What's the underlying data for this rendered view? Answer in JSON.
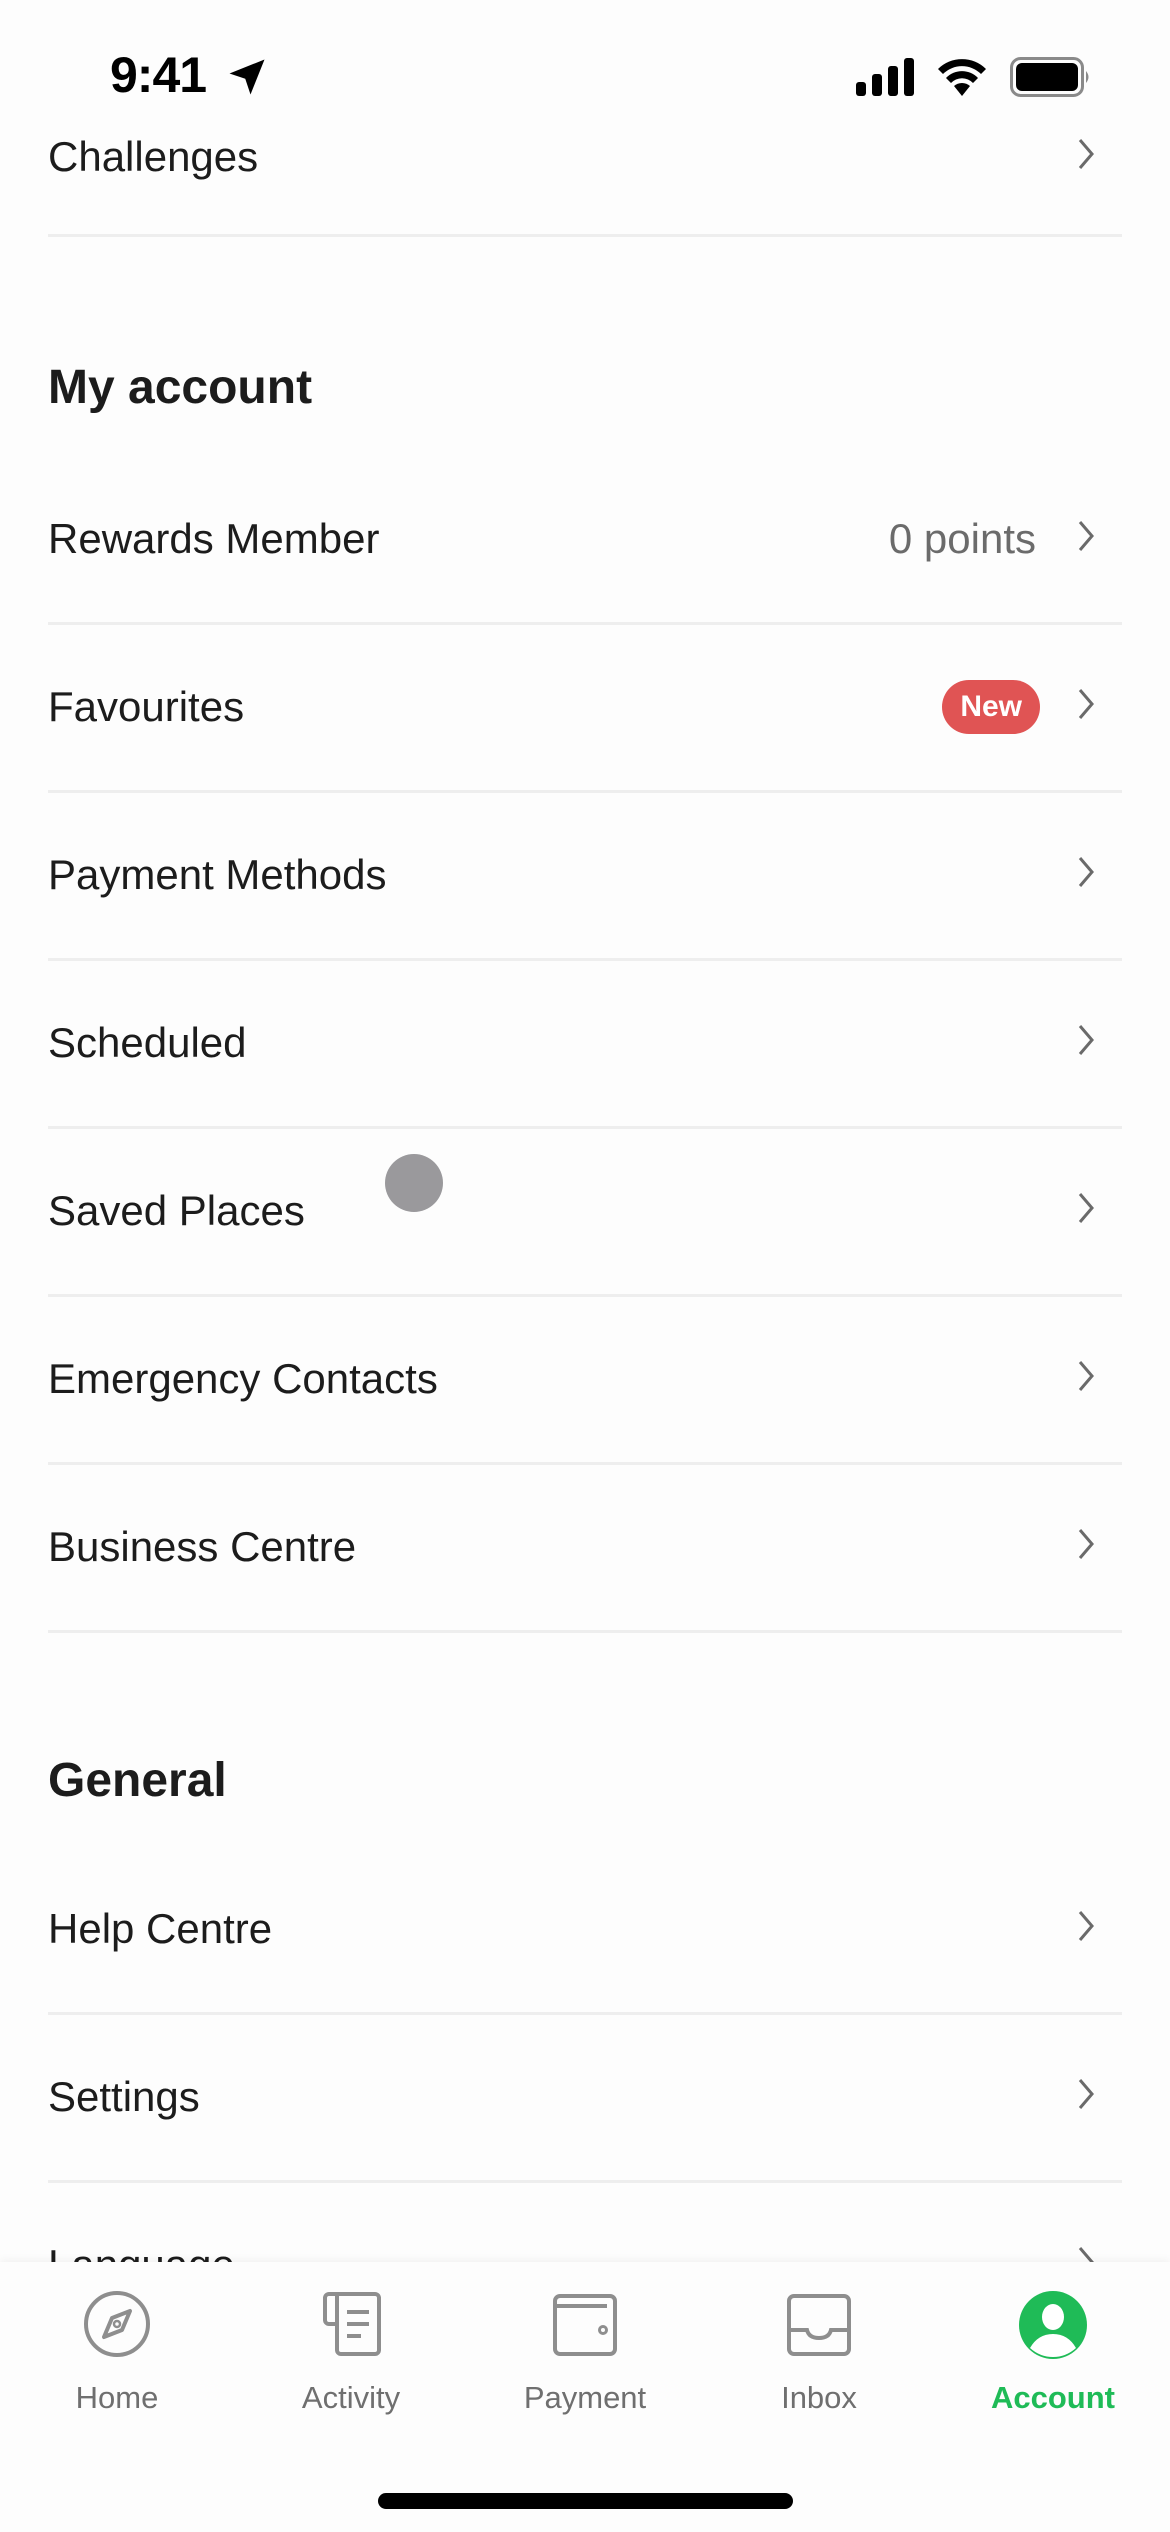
{
  "status_bar": {
    "time": "9:41",
    "icons": [
      "location-arrow-icon",
      "cellular-signal-icon",
      "wifi-icon",
      "battery-icon"
    ]
  },
  "top_row": {
    "label": "Challenges"
  },
  "my_account": {
    "title": "My account",
    "items": [
      {
        "label": "Rewards Member",
        "value": "0 points"
      },
      {
        "label": "Favourites",
        "badge": "New"
      },
      {
        "label": "Payment Methods"
      },
      {
        "label": "Scheduled"
      },
      {
        "label": "Saved Places"
      },
      {
        "label": "Emergency Contacts"
      },
      {
        "label": "Business Centre"
      }
    ]
  },
  "general": {
    "title": "General",
    "items": [
      {
        "label": "Help Centre"
      },
      {
        "label": "Settings"
      },
      {
        "label": "Language"
      }
    ]
  },
  "tab_bar": {
    "active": "Account",
    "accent_color": "#1fbb57",
    "tabs": [
      {
        "label": "Home",
        "icon": "compass-icon"
      },
      {
        "label": "Activity",
        "icon": "receipt-icon"
      },
      {
        "label": "Payment",
        "icon": "wallet-icon"
      },
      {
        "label": "Inbox",
        "icon": "inbox-icon"
      },
      {
        "label": "Account",
        "icon": "account-icon"
      }
    ]
  },
  "colors": {
    "badge": "#e05454",
    "accent": "#1fbb57",
    "text": "#1c1c1c",
    "muted": "#6b6b6b"
  }
}
